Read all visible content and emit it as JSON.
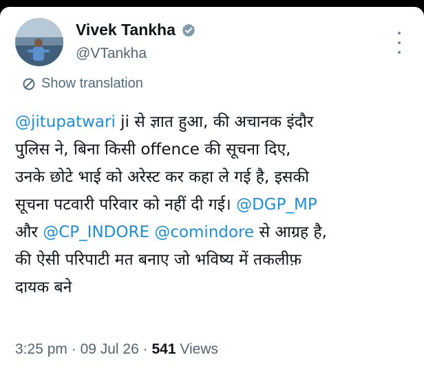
{
  "author": {
    "display_name": "Vivek Tankha",
    "handle": "@VTankha",
    "verified_icon": "verified-badge-icon"
  },
  "translate_label": "Show translation",
  "tweet": {
    "line1_mention": "@jitupatwari",
    "line1_text": " ji से ज्ञात हुआ, की अचानक इंदौर",
    "line2": "पुलिस ने, बिना किसी offence की सूचना दिए,",
    "line3": "उनके छोटे भाई को अरेस्ट कर कहा ले गई है, इसकी",
    "line4_text": "सूचना पटवारी परिवार को नहीं दी गई। ",
    "line4_mention": "@DGP_MP",
    "line5_prefix": "और ",
    "line5_mention1": "@CP_INDORE",
    "line5_space": " ",
    "line5_mention2": "@comindore",
    "line5_suffix": " से आग्रह है,",
    "line6": "की ऐसी परिपाटी मत बनाए जो भविष्य में तकलीफ़",
    "line7": "दायक बने"
  },
  "meta": {
    "time": "3:25 pm",
    "sep1": " · ",
    "date": "09 Jul 26",
    "sep2": " · ",
    "views_count": "541",
    "views_label": " Views"
  },
  "colors": {
    "mention": "#1d8fd8",
    "verified": "#829aab",
    "secondary": "#536471"
  }
}
